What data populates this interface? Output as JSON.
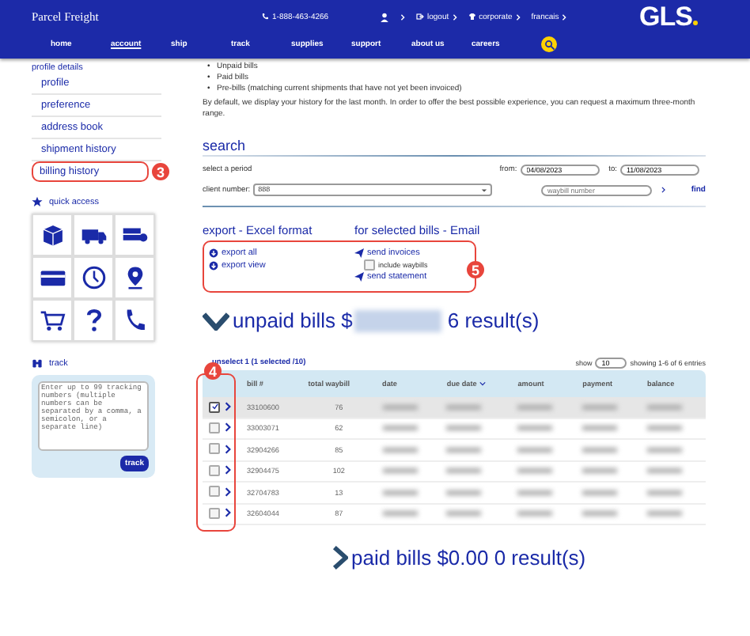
{
  "header": {
    "brand": "Parcel Freight",
    "phone": "1-888-463-4266",
    "top_links": [
      {
        "label": "logout"
      },
      {
        "label": "corporate"
      },
      {
        "label": "francais"
      }
    ],
    "logo": "GLS",
    "nav": [
      {
        "label": "home",
        "selected": false
      },
      {
        "label": "account",
        "selected": true
      },
      {
        "label": "ship",
        "selected": false
      },
      {
        "label": "track",
        "selected": false
      },
      {
        "label": "supplies",
        "selected": false
      },
      {
        "label": "support",
        "selected": false
      },
      {
        "label": "about us",
        "selected": false
      },
      {
        "label": "careers",
        "selected": false
      }
    ]
  },
  "sidebar": {
    "section": "profile details",
    "items": [
      {
        "label": "profile",
        "selected": false
      },
      {
        "label": "preference",
        "selected": false
      },
      {
        "label": "address book",
        "selected": false
      },
      {
        "label": "shipment history",
        "selected": false
      },
      {
        "label": "billing history",
        "selected": true
      }
    ],
    "quick_access": "quick access",
    "track_title": "track",
    "track_placeholder": "Enter up to 99 tracking numbers (multiple numbers can be separated by a comma, a semicolon, or a separate line)",
    "track_button": "track"
  },
  "badges": [
    "3",
    "4",
    "5"
  ],
  "intro": {
    "marker": "•",
    "bullets": [
      "Unpaid bills",
      "Paid bills",
      "Pre-bills (matching current shipments that have not yet been invoiced)"
    ],
    "paragraph": "By default, we display your history for the last month. In order to offer the best possible experience, you can request a maximum three-month range."
  },
  "search": {
    "title": "search",
    "period_label": "select a period",
    "from_label": "from:",
    "from_value": "04/08/2023",
    "to_label": "to:",
    "to_value": "11/08/2023",
    "client_label": "client number:",
    "client_value": "888",
    "waybill_placeholder": "waybill number",
    "find": "find"
  },
  "export": {
    "excel_title": "export - Excel format",
    "excel_links": [
      "export all",
      "export view"
    ],
    "email_title": "for selected bills - Email",
    "send_invoices": "send invoices",
    "include_waybills": {
      "label": "include waybills",
      "checked": false
    },
    "send_statement": "send statement"
  },
  "unpaid": {
    "title": "unpaid bills $",
    "results": "6 result(s)",
    "expanded": true
  },
  "table": {
    "unselect": "unselect 1 (1 selected /10)",
    "show_label": "show",
    "show_value": "10",
    "entries": "showing 1-6 of 6 entries",
    "columns": [
      "bill #",
      "total waybill",
      "date",
      "due date",
      "amount",
      "payment",
      "balance"
    ],
    "rows": [
      {
        "bill": "33100600",
        "waybill": "76",
        "selected": true
      },
      {
        "bill": "33003071",
        "waybill": "62",
        "selected": false
      },
      {
        "bill": "32904266",
        "waybill": "85",
        "selected": false
      },
      {
        "bill": "32904475",
        "waybill": "102",
        "selected": false
      },
      {
        "bill": "32704783",
        "waybill": "13",
        "selected": false
      },
      {
        "bill": "32604044",
        "waybill": "87",
        "selected": false
      }
    ]
  },
  "paid": {
    "title": "paid bills $0.00 0 result(s)",
    "expanded": false
  }
}
